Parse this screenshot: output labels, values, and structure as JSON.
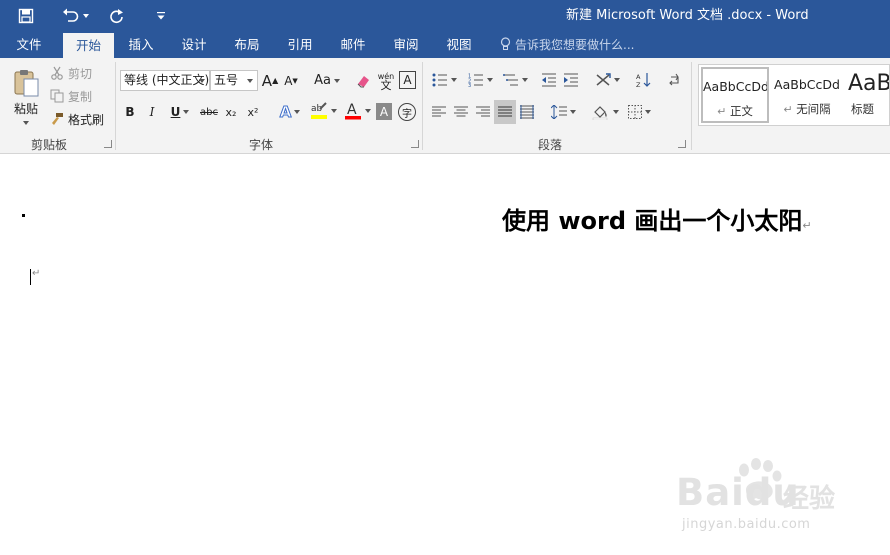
{
  "window": {
    "title": "新建 Microsoft Word 文档 .docx - Word"
  },
  "tabs": [
    {
      "label": "文件"
    },
    {
      "label": "开始"
    },
    {
      "label": "插入"
    },
    {
      "label": "设计"
    },
    {
      "label": "布局"
    },
    {
      "label": "引用"
    },
    {
      "label": "邮件"
    },
    {
      "label": "审阅"
    },
    {
      "label": "视图"
    }
  ],
  "active_tab": "开始",
  "tell_me": {
    "placeholder": "告诉我您想要做什么..."
  },
  "clipboard": {
    "paste": "粘贴",
    "cut": "剪切",
    "copy": "复制",
    "format_painter": "格式刷",
    "group_label": "剪贴板"
  },
  "font": {
    "font_name": "等线 (中文正文)",
    "font_size": "五号",
    "case_label": "Aa",
    "group_label": "字体",
    "bold": "B",
    "italic": "I",
    "underline": "U",
    "strike": "abc",
    "subscript": "x₂",
    "superscript": "x²",
    "pinyin": "wén",
    "pinyin_char": "文",
    "border_char": "A",
    "shade_char": "A",
    "circle_char": "字",
    "color_char": "A",
    "grow_char": "A",
    "shrink_char": "A"
  },
  "paragraph": {
    "group_label": "段落"
  },
  "styles": [
    {
      "sample": "AaBbCcDd",
      "name": "正文"
    },
    {
      "sample": "AaBbCcDd",
      "name": "无间隔"
    },
    {
      "sample": "AaBl",
      "name": "标题"
    }
  ],
  "document": {
    "heading": "使用 word 画出一个小太阳"
  },
  "watermark": {
    "brand": "Baidu",
    "brand_cn": "经验",
    "url": "jingyan.baidu.com"
  },
  "colors": {
    "title_bar": "#2b579a",
    "ribbon": "#f3f3f3",
    "highlight_yellow": "#ffff00",
    "font_color_red": "#ff0000"
  }
}
